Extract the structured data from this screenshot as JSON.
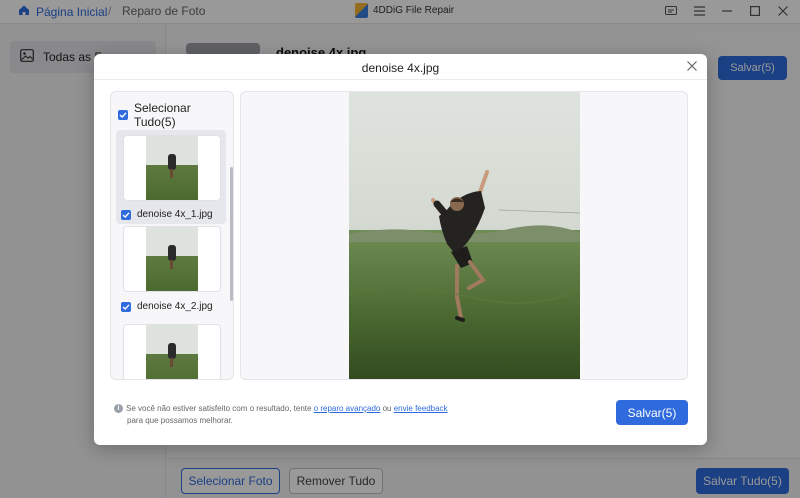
{
  "titlebar": {
    "home_label": "Página Inicial",
    "separator": "/",
    "current_page": "Reparo de Foto",
    "app_name": "4DDiG File Repair",
    "controls": [
      "feedback-icon",
      "menu-icon",
      "minimize-icon",
      "maximize-icon",
      "close-icon"
    ]
  },
  "sidebar": {
    "items": [
      {
        "label": "Todas as Fo...",
        "icon": "image-icon"
      }
    ]
  },
  "background": {
    "file_name": "denoise 4x.jpg",
    "save_label": "Salvar(5)",
    "select_photo_label": "Selecionar Foto",
    "remove_all_label": "Remover Tudo",
    "save_all_label": "Salvar Tudo(5)"
  },
  "modal": {
    "title": "denoise 4x.jpg",
    "select_all_label": "Selecionar Tudo(5)",
    "files": [
      {
        "name": "denoise 4x_1.jpg",
        "checked": true,
        "selected": true
      },
      {
        "name": "denoise 4x_2.jpg",
        "checked": true,
        "selected": false
      },
      {
        "name": "",
        "checked": true,
        "selected": false
      }
    ],
    "hint": {
      "text_before": "Se você não estiver satisfeito com o resultado, tente ",
      "link1": "o reparo avançado",
      "text_mid": " ou ",
      "link2": "envie feedback",
      "line2": "para que possamos melhorar."
    },
    "save_label": "Salvar(5)"
  },
  "colors": {
    "accent": "#2f6bdc",
    "overlay": "rgba(0,0,0,0.4)"
  }
}
